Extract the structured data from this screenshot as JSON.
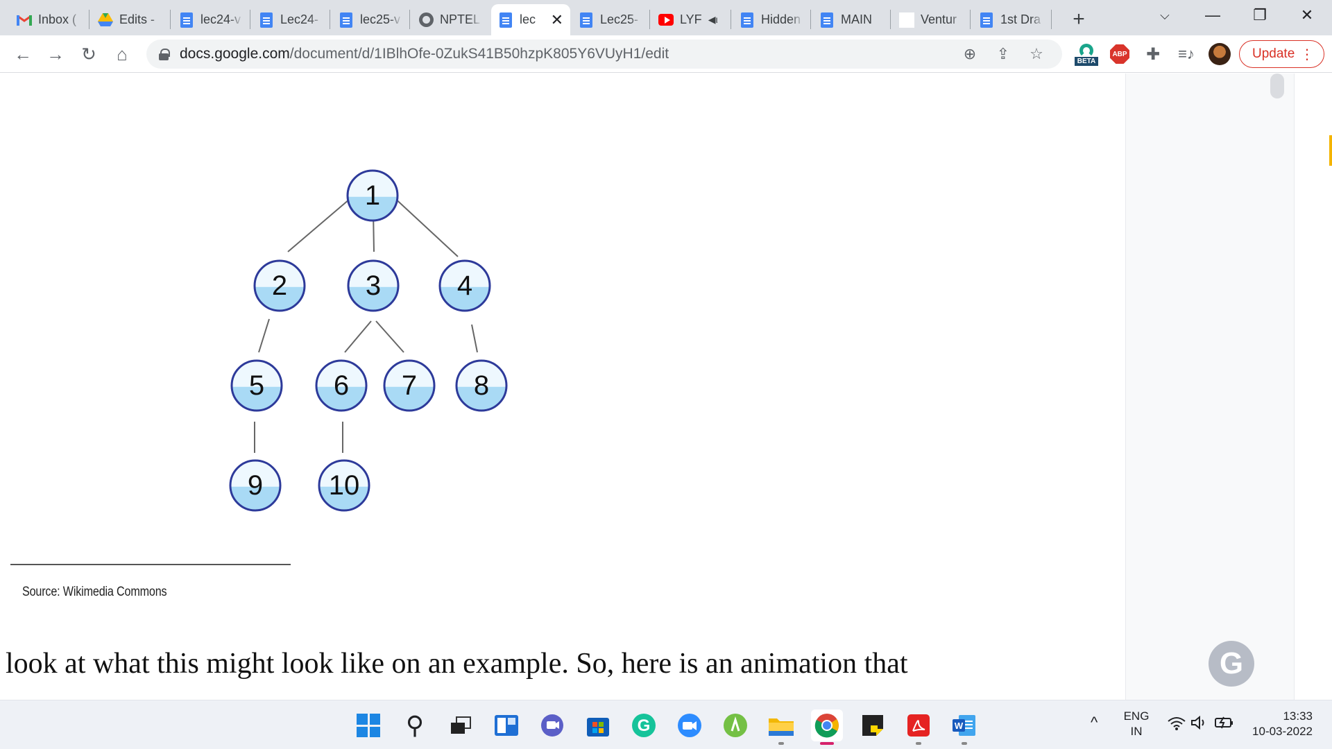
{
  "browser": {
    "tabs": [
      {
        "title": "Inbox (",
        "icon": "gmail-icon"
      },
      {
        "title": "Edits -",
        "icon": "google-drive-icon"
      },
      {
        "title": "lec24-v",
        "icon": "google-docs-icon"
      },
      {
        "title": "Lec24-",
        "icon": "google-docs-icon"
      },
      {
        "title": "lec25-v",
        "icon": "google-docs-icon"
      },
      {
        "title": "NPTEL",
        "icon": "globe-icon"
      },
      {
        "title": "lec",
        "icon": "google-docs-icon",
        "active": true
      },
      {
        "title": "Lec25-",
        "icon": "google-docs-icon"
      },
      {
        "title": "LYF",
        "icon": "youtube-icon",
        "audio": true
      },
      {
        "title": "Hidden",
        "icon": "google-docs-icon"
      },
      {
        "title": "MAIN",
        "icon": "google-docs-icon"
      },
      {
        "title": "Ventur",
        "icon": "blank-page-icon"
      },
      {
        "title": "1st Dra",
        "icon": "google-docs-icon"
      }
    ],
    "url_host": "docs.google.com",
    "url_path": "/document/d/1IBlhOfe-0ZukS41B50hzpK805Y6VUyH1/edit",
    "update_label": "Update",
    "beta_label": "BETA",
    "abp_label": "ABP"
  },
  "document": {
    "tree_nodes": [
      "1",
      "2",
      "3",
      "4",
      "5",
      "6",
      "7",
      "8",
      "9",
      "10"
    ],
    "source_note": "Source: Wikimedia Commons",
    "body_text": "look at what this might look like on an example. So, here is an animation that"
  },
  "taskbar": {
    "apps": [
      "windows-start",
      "search",
      "task-view",
      "widgets",
      "teams-chat",
      "microsoft-store",
      "grammarly",
      "zoom",
      "evernote",
      "file-explorer",
      "chrome",
      "sticky-notes",
      "acrobat-reader",
      "word"
    ],
    "language": "ENG",
    "region": "IN",
    "time": "13:33",
    "date": "10-03-2022"
  },
  "colors": {
    "node_fill_top": "#e9f6fd",
    "node_fill_bottom": "#a9daf5",
    "node_stroke": "#2d3a9a",
    "update_red": "#d93025",
    "tabstrip_bg": "#dee1e6"
  }
}
